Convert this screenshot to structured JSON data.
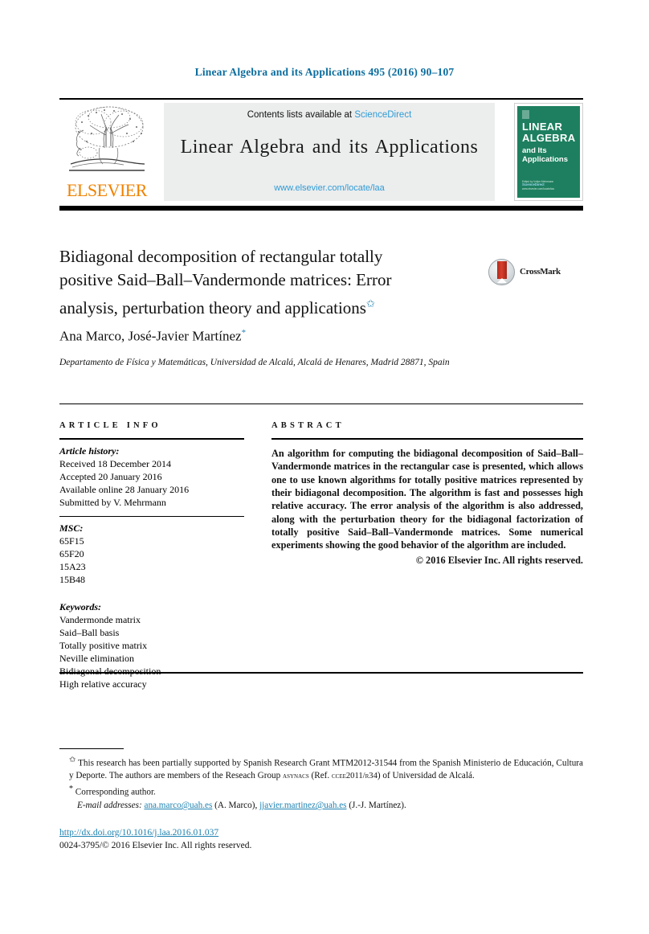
{
  "running_head": "Linear Algebra and its Applications 495 (2016) 90–107",
  "masthead": {
    "publisher_logo_word": "ELSEVIER",
    "publisher_logo_icon": "elsevier-tree-icon",
    "contents_prefix": "Contents lists available at ",
    "contents_link": "ScienceDirect",
    "journal_title": "Linear Algebra and its Applications",
    "journal_url": "www.elsevier.com/locate/laa",
    "cover": {
      "line1": "LINEAR",
      "line2": "ALGEBRA",
      "line3": "and Its",
      "line4": "Applications",
      "footer_small": "Edited by Volker Mehrmann",
      "footer_sd": "ScienceDirect",
      "footer_url": "www.elsevier.com/locate/laa",
      "background_color": "#1d7f5f"
    }
  },
  "article": {
    "title": "Bidiagonal decomposition of rectangular totally positive Said–Ball–Vandermonde matrices: Error analysis, perturbation theory and applications",
    "title_footnote_mark": "✩",
    "crossmark_label": "CrossMark",
    "authors": "Ana Marco, José-Javier Martínez",
    "author_footnote_mark": "*",
    "affiliation": "Departamento de Física y Matemáticas, Universidad de Alcalá, Alcalá de Henares, Madrid 28871, Spain"
  },
  "article_info": {
    "heading": "ARTICLE INFO",
    "history_label": "Article history:",
    "history": [
      "Received 18 December 2014",
      "Accepted 20 January 2016",
      "Available online 28 January 2016",
      "Submitted by V. Mehrmann"
    ],
    "msc_label": "MSC:",
    "msc": [
      "65F15",
      "65F20",
      "15A23",
      "15B48"
    ],
    "keywords_label": "Keywords:",
    "keywords": [
      "Vandermonde matrix",
      "Said–Ball basis",
      "Totally positive matrix",
      "Neville elimination",
      "Bidiagonal decomposition",
      "High relative accuracy"
    ]
  },
  "abstract": {
    "heading": "ABSTRACT",
    "text": "An algorithm for computing the bidiagonal decomposition of Said–Ball–Vandermonde matrices in the rectangular case is presented, which allows one to use known algorithms for totally positive matrices represented by their bidiagonal decomposition. The algorithm is fast and possesses high relative accuracy. The error analysis of the algorithm is also addressed, along with the perturbation theory for the bidiagonal factorization of totally positive Said–Ball–Vandermonde matrices. Some numerical experiments showing the good behavior of the algorithm are included.",
    "copyright": "© 2016 Elsevier Inc. All rights reserved."
  },
  "footnotes": {
    "grant_mark": "✩",
    "grant_text_part1": "This research has been partially supported by Spanish Research Grant MTM2012-31544 from the Spanish Ministerio de Educación, Cultura y Deporte. The authors are members of the Reseach Group ",
    "grant_group": "asynacs",
    "grant_text_part2": " (Ref. ",
    "grant_ref": "ccee2011/r34",
    "grant_text_part3": ") of Universidad de Alcalá.",
    "corresponding_mark": "*",
    "corresponding_text": "Corresponding author.",
    "email_label": "E-mail addresses:",
    "emails": [
      {
        "address": "ana.marco@uah.es",
        "owner": "(A. Marco),"
      },
      {
        "address": "jjavier.martinez@uah.es",
        "owner": "(J.-J. Martínez)."
      }
    ]
  },
  "footer": {
    "doi": "http://dx.doi.org/10.1016/j.laa.2016.01.037",
    "issn_line": "0024-3795/© 2016 Elsevier Inc. All rights reserved."
  },
  "colors": {
    "link_blue": "#1f82b0",
    "sciencedirect_blue": "#2e9bd6",
    "elsevier_orange": "#ef8200",
    "cover_green": "#1d7f5f",
    "crossmark_red": "#c0301f"
  }
}
